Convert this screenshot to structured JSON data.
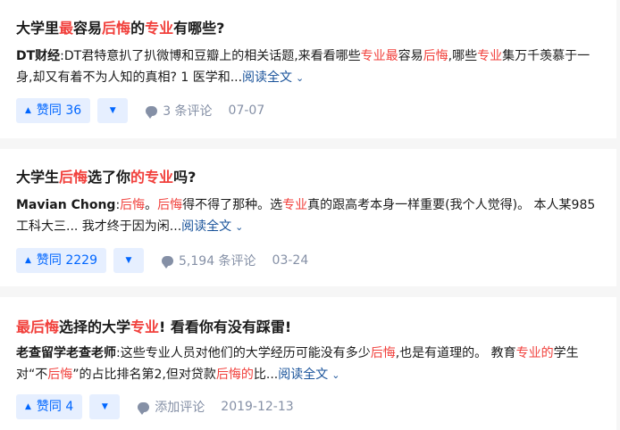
{
  "cards": [
    {
      "title_parts": [
        {
          "text": "大学里",
          "hl": false
        },
        {
          "text": "最",
          "hl": true
        },
        {
          "text": "容易",
          "hl": false
        },
        {
          "text": "后悔",
          "hl": true
        },
        {
          "text": "的",
          "hl": false
        },
        {
          "text": "专业",
          "hl": true
        },
        {
          "text": "有哪些?",
          "hl": false
        }
      ],
      "author": "DT财经",
      "excerpt_parts": [
        {
          "text": ":DT君特意扒了扒微博和豆瓣上的相关话题,来看看哪些",
          "hl": false
        },
        {
          "text": "专业",
          "hl": true
        },
        {
          "text": "最",
          "hl": true
        },
        {
          "text": "容易",
          "hl": false
        },
        {
          "text": "后悔",
          "hl": true
        },
        {
          "text": ",哪些",
          "hl": false
        },
        {
          "text": "专业",
          "hl": true
        },
        {
          "text": "集万千羡慕于一身,却又有着不为人知的真相? 1 医学和...",
          "hl": false
        }
      ],
      "read_more": "阅读全文",
      "vote_label": "赞同 36",
      "comment_label": "3 条评论",
      "date": "07-07"
    },
    {
      "title_parts": [
        {
          "text": "大学生",
          "hl": false
        },
        {
          "text": "后悔",
          "hl": true
        },
        {
          "text": "选了你",
          "hl": false
        },
        {
          "text": "的专业",
          "hl": true
        },
        {
          "text": "吗?",
          "hl": false
        }
      ],
      "author": "Mavian Chong",
      "excerpt_parts": [
        {
          "text": ":",
          "hl": false
        },
        {
          "text": "后悔",
          "hl": true
        },
        {
          "text": "。",
          "hl": false
        },
        {
          "text": "后悔",
          "hl": true
        },
        {
          "text": "得不得了那种。选",
          "hl": false
        },
        {
          "text": "专业",
          "hl": true
        },
        {
          "text": "真的跟高考本身一样重要(我个人觉得)。 本人某985工科大三... 我才终于因为闲...",
          "hl": false
        }
      ],
      "read_more": "阅读全文",
      "vote_label": "赞同 2229",
      "comment_label": "5,194 条评论",
      "date": "03-24"
    },
    {
      "title_parts": [
        {
          "text": "最后悔",
          "hl": true
        },
        {
          "text": "选择的大学",
          "hl": false
        },
        {
          "text": "专业",
          "hl": true
        },
        {
          "text": "! 看看你有没有踩雷!",
          "hl": false
        }
      ],
      "author": "老查留学老查老师",
      "excerpt_parts": [
        {
          "text": ":这些专业人员对他们的大学经历可能没有多少",
          "hl": false
        },
        {
          "text": "后悔",
          "hl": true
        },
        {
          "text": ",也是有道理的。 教育",
          "hl": false
        },
        {
          "text": "专业的",
          "hl": true
        },
        {
          "text": "学生对“不",
          "hl": false
        },
        {
          "text": "后悔",
          "hl": true
        },
        {
          "text": "”的占比排名第2,但对贷款",
          "hl": false
        },
        {
          "text": "后悔的",
          "hl": true
        },
        {
          "text": "比...",
          "hl": false
        }
      ],
      "read_more": "阅读全文",
      "vote_label": "赞同 4",
      "comment_label": "添加评论",
      "date": "2019-12-13"
    }
  ],
  "icons": {
    "upvote": "triangle-up-icon",
    "downvote": "triangle-down-icon",
    "comment": "comment-bubble-icon",
    "chevron": "chevron-down-icon"
  },
  "colors": {
    "highlight": "#f1403c",
    "link": "#175199",
    "vote_bg": "#e6efff",
    "vote_fg": "#0066ff",
    "meta": "#8590a6"
  }
}
